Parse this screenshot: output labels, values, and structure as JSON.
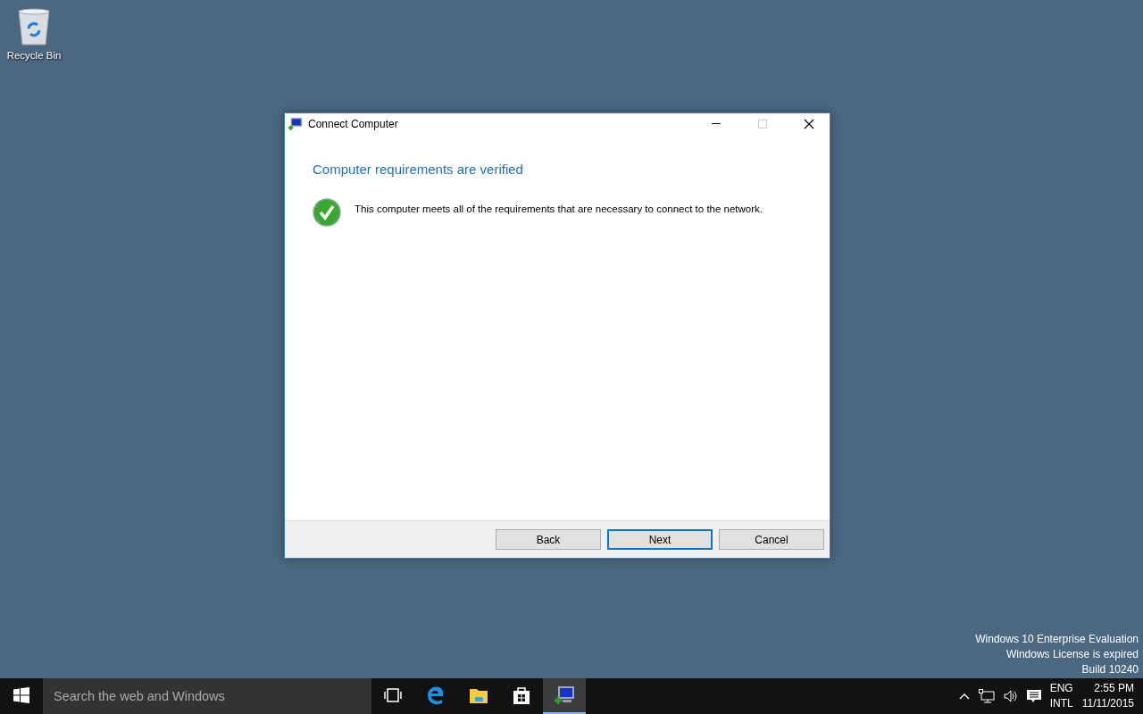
{
  "desktop": {
    "icons": [
      {
        "label": "Recycle Bin"
      }
    ],
    "evaluation_notice": [
      "Windows 10 Enterprise Evaluation",
      "Windows License is expired",
      "Build 10240"
    ]
  },
  "window": {
    "title": "Connect Computer",
    "heading": "Computer requirements are verified",
    "message": "This computer meets all of the requirements that are necessary to connect to the network.",
    "buttons": [
      {
        "label": "Back",
        "default": false
      },
      {
        "label": "Next",
        "default": true
      },
      {
        "label": "Cancel",
        "default": false
      }
    ]
  },
  "taskbar": {
    "search": {
      "placeholder": "Search the web and Windows"
    },
    "apps": [
      {
        "kind": "taskview",
        "active": false
      },
      {
        "kind": "browser",
        "active": false
      },
      {
        "kind": "folder",
        "active": false
      },
      {
        "kind": "store",
        "active": false
      },
      {
        "kind": "connect",
        "active": true
      }
    ],
    "language": [
      "ENG",
      "INTL"
    ],
    "time": "2:55 PM",
    "date": "11/11/2015"
  }
}
